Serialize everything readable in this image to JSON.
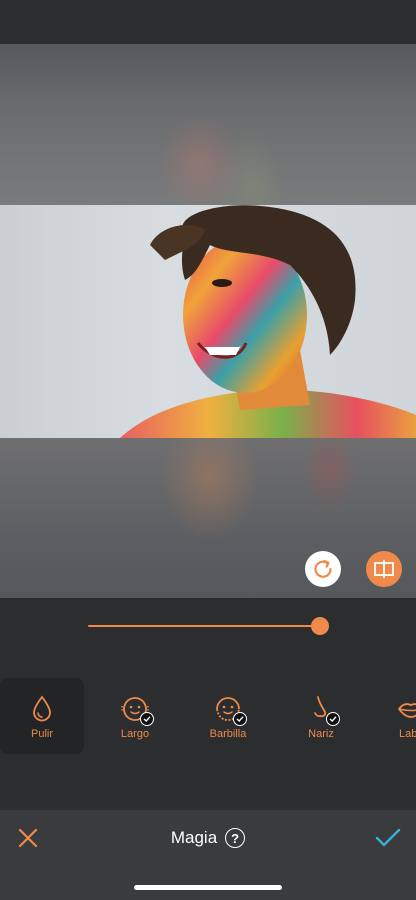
{
  "colors": {
    "accent": "#f08a4b",
    "confirm": "#3ab0d8",
    "panel": "#2c2d2f",
    "bottom_bar": "#3a3b3d"
  },
  "editor": {
    "slider": {
      "value": 1.0
    },
    "actions": {
      "rotate_icon": "rotate-icon",
      "compare_icon": "compare-split-icon"
    }
  },
  "tools": [
    {
      "label": "Pulir",
      "icon": "drop-icon",
      "active": true,
      "checked": false
    },
    {
      "label": "Largo",
      "icon": "face-icon",
      "active": false,
      "checked": true
    },
    {
      "label": "Barbilla",
      "icon": "face-icon",
      "active": false,
      "checked": true
    },
    {
      "label": "Nariz",
      "icon": "nose-icon",
      "active": false,
      "checked": true
    },
    {
      "label": "Lab",
      "icon": "lips-icon",
      "active": false,
      "checked": false
    }
  ],
  "bottom_bar": {
    "title": "Magia",
    "help_symbol": "?",
    "cancel_icon": "close-icon",
    "confirm_icon": "checkmark-icon"
  }
}
